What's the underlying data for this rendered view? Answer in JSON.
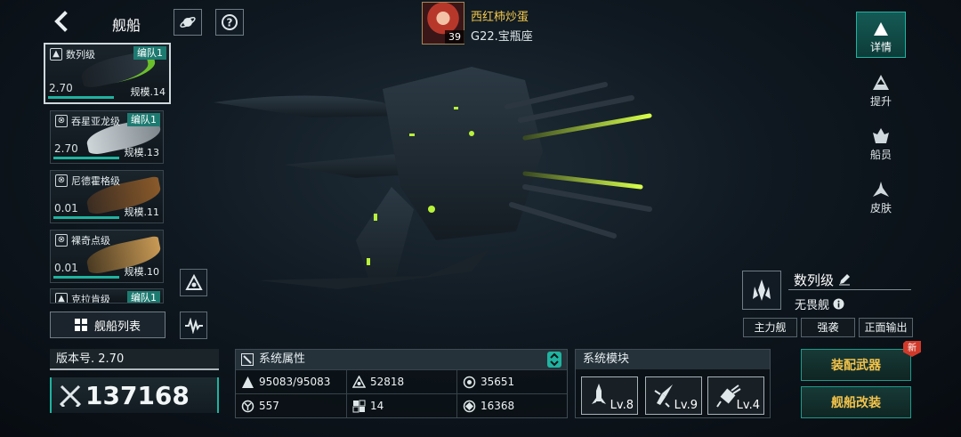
{
  "header": {
    "title": "舰船"
  },
  "player": {
    "name": "西红柿炒蛋",
    "server": "G22.宝瓶座",
    "level": "39"
  },
  "ship_list": [
    {
      "name": "数列级",
      "fleet": "编队1",
      "version": "2.70",
      "scale": "规模.14",
      "selected": true
    },
    {
      "name": "吞星亚龙级",
      "fleet": "编队1",
      "version": "2.70",
      "scale": "规模.13",
      "selected": false
    },
    {
      "name": "尼德霍格级",
      "fleet": "",
      "version": "0.01",
      "scale": "规模.11",
      "selected": false
    },
    {
      "name": "裸奇点级",
      "fleet": "",
      "version": "0.01",
      "scale": "规模.10",
      "selected": false
    },
    {
      "name": "克拉肯级",
      "fleet": "编队1",
      "version": "",
      "scale": "",
      "selected": false
    }
  ],
  "ship_list_button": "舰船列表",
  "version_panel": {
    "label": "版本号. 2.70",
    "power": "137168"
  },
  "system_attributes": {
    "title": "系统属性",
    "cells": [
      {
        "icon": "hull-icon",
        "value": "95083/95083"
      },
      {
        "icon": "armor-icon",
        "value": "52818"
      },
      {
        "icon": "shield-icon",
        "value": "35651"
      },
      {
        "icon": "speed-icon",
        "value": "557"
      },
      {
        "icon": "grid-icon",
        "value": "14"
      },
      {
        "icon": "target-icon",
        "value": "16368"
      }
    ]
  },
  "system_modules": {
    "title": "系统模块",
    "modules": [
      {
        "icon": "missile-icon",
        "level": "Lv.8"
      },
      {
        "icon": "rocket-icon",
        "level": "Lv.9"
      },
      {
        "icon": "turret-icon",
        "level": "Lv.4"
      }
    ]
  },
  "actions": {
    "equip_weapons": "装配武器",
    "modify_ship": "舰船改装",
    "new_badge": "新"
  },
  "nav": [
    {
      "label": "详情",
      "active": true
    },
    {
      "label": "提升",
      "active": false
    },
    {
      "label": "船员",
      "active": false
    },
    {
      "label": "皮肤",
      "active": false
    }
  ],
  "ship_info": {
    "class_name": "数列级",
    "type": "无畏舰",
    "tags": [
      "主力舰",
      "强袭",
      "正面输出"
    ]
  },
  "colors": {
    "accent": "#1fb3a0",
    "gold": "#f3c34a",
    "fleet": "#1d7a71",
    "glow": "#b8f23a"
  }
}
